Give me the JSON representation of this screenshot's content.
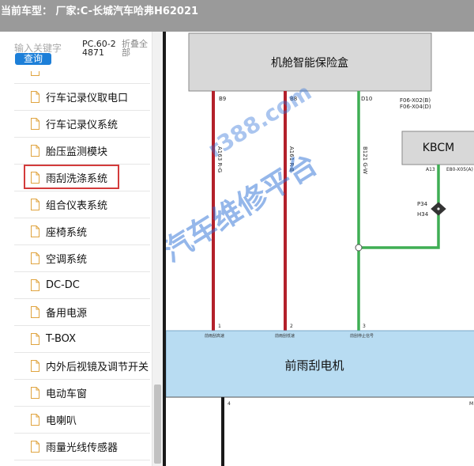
{
  "titlebar": {
    "text": "当前车型：  厂家:C-长城汽车哈弗H62021"
  },
  "search": {
    "placeholder": "输入关键字",
    "button_label": "查询"
  },
  "pc_number": "PC.60-24871",
  "collapse_label": "折叠全部",
  "tree": {
    "items": [
      {
        "label": ""
      },
      {
        "label": "行车记录仪取电口"
      },
      {
        "label": "行车记录仪系统"
      },
      {
        "label": "胎压监测模块"
      },
      {
        "label": "雨刮洗涤系统",
        "highlighted": true
      },
      {
        "label": "组合仪表系统"
      },
      {
        "label": "座椅系统"
      },
      {
        "label": "空调系统"
      },
      {
        "label": "DC-DC"
      },
      {
        "label": "备用电源"
      },
      {
        "label": "T-BOX"
      },
      {
        "label": "内外后视镜及调节开关"
      },
      {
        "label": "电动车窗"
      },
      {
        "label": "电喇叭"
      },
      {
        "label": "雨量光线传感器"
      }
    ]
  },
  "diagram": {
    "top_box_label": "机舱智能保险盒",
    "kbcm_label": "KBCM",
    "motor_label": "前雨刮电机",
    "pins": {
      "b9": "B9",
      "b8": "B8",
      "d10": "D10",
      "a13": "A13"
    },
    "connector_refs": {
      "line1": "F06-X02(B)",
      "line2": "F06-X04(D)",
      "kbcm_ref": "E80-X05(A)"
    },
    "wires": {
      "w1": "A163 R-G",
      "w2": "A161 R-B",
      "w3": "B121 G-W"
    },
    "junction": {
      "p34": "P34",
      "h34": "H34"
    },
    "motor_pins": {
      "p1": "1",
      "p2": "2",
      "p3": "3",
      "p4": "4",
      "pm": "M"
    },
    "motor_pin_labels": {
      "l1": "前雨刮高速",
      "l2": "前雨刮低速",
      "l3": "前刮停止信号"
    },
    "watermark_url": "r388.com",
    "watermark_text": "汽车维修平台"
  },
  "colors": {
    "titlebar_bg": "#9a9a9a",
    "accent_blue": "#1d7fd8",
    "highlight_red": "#d33b3b",
    "wire_red": "#b3202a",
    "wire_green": "#3fae54",
    "wire_black": "#1a1a1a",
    "motor_fill": "#b8dcf2",
    "box_fill": "#d8d8d8",
    "watermark": "#2b6fd6"
  }
}
